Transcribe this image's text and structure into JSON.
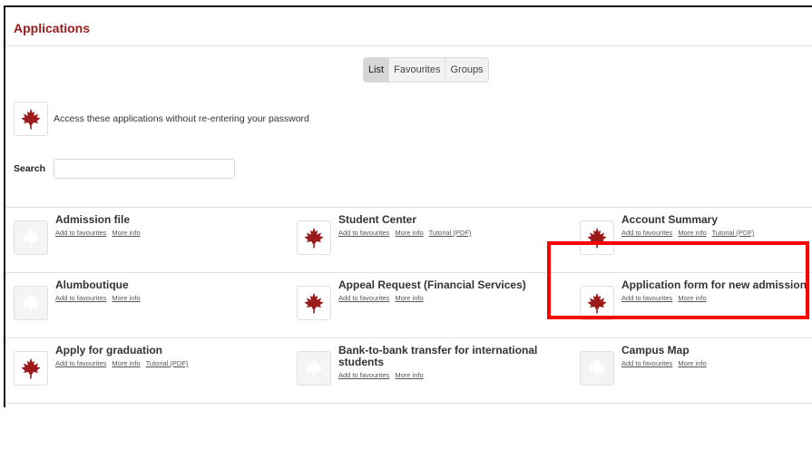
{
  "header": {
    "title": "Applications"
  },
  "tabs": [
    {
      "label": "List",
      "active": true
    },
    {
      "label": "Favourites",
      "active": false
    },
    {
      "label": "Groups",
      "active": false
    }
  ],
  "notice": {
    "text": "Access these applications without re-entering your password"
  },
  "search": {
    "label": "Search",
    "value": "",
    "placeholder": ""
  },
  "link_labels": {
    "favourites": "Add to favourites",
    "more_info": "More info",
    "tutorial": "Tutorial (PDF)"
  },
  "apps": [
    {
      "name": "Admission file",
      "icon": "maple-leaf-gray-icon"
    },
    {
      "name": "Student Center",
      "icon": "maple-leaf-red-icon"
    },
    {
      "name": "Account Summary",
      "icon": "maple-leaf-red-icon"
    },
    {
      "name": "Alumboutique",
      "icon": "maple-leaf-gray-icon"
    },
    {
      "name": "Appeal Request (Financial Services)",
      "icon": "maple-leaf-red-icon"
    },
    {
      "name": "Application form for new admission",
      "icon": "maple-leaf-red-icon"
    },
    {
      "name": "Apply for graduation",
      "icon": "maple-leaf-red-icon"
    },
    {
      "name": "Bank-to-bank transfer for international students",
      "icon": "maple-leaf-gray-icon"
    },
    {
      "name": "Campus Map",
      "icon": "maple-leaf-gray-icon"
    }
  ],
  "colors": {
    "brand": "#9b1b1b",
    "highlight": "#ff0000"
  }
}
